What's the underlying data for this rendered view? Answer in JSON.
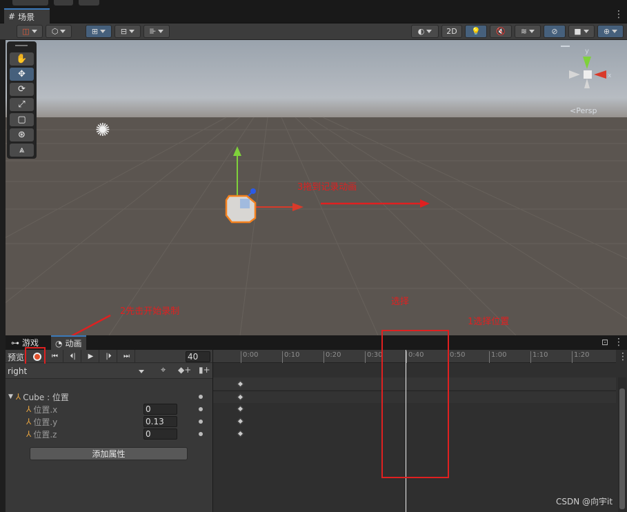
{
  "scene_tab": {
    "icon": "grid-icon",
    "label": "场景"
  },
  "scene_toolbar": {
    "mode_2d": "2D"
  },
  "gizmo": {
    "y_axis": "y",
    "x_axis": "x",
    "projection": "<Persp"
  },
  "tools": [
    "hand-icon",
    "move-icon",
    "rotate-icon",
    "scale-icon",
    "rect-icon",
    "transform-icon",
    "custom-tool-icon"
  ],
  "annotations": {
    "step1": "1选择位置",
    "step2": "2先击开始录制",
    "step3": "3拖到记录动画",
    "select": "选择"
  },
  "bottom_tabs": {
    "game": "游戏",
    "animation": "动画"
  },
  "animation": {
    "preview_label": "预览",
    "frame": "40",
    "clip_name": "right",
    "object_label": "Cube : 位置",
    "properties": [
      {
        "label": "位置.x",
        "value": "0"
      },
      {
        "label": "位置.y",
        "value": "0.13"
      },
      {
        "label": "位置.z",
        "value": "0"
      }
    ],
    "add_property": "添加属性",
    "ruler": [
      "0:00",
      "0:10",
      "0:20",
      "0:30",
      "0:40",
      "0:50",
      "1:00",
      "1:10",
      "1:20"
    ]
  },
  "watermark": "CSDN @向宇it",
  "colors": {
    "accent_blue": "#3a79bb",
    "annotation_red": "#e02020",
    "selection_orange": "#f5821f",
    "record_red": "#e0502b"
  }
}
